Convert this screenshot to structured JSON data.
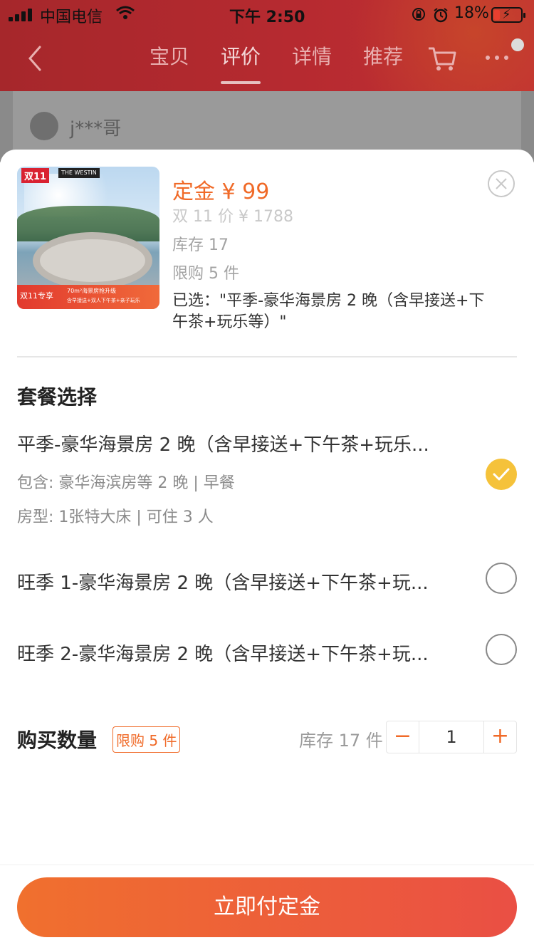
{
  "status_bar": {
    "carrier": "中国电信",
    "time": "下午 2:50",
    "battery": "18%"
  },
  "header": {
    "tabs": [
      "宝贝",
      "评价",
      "详情",
      "推荐"
    ],
    "active_tab": "评价"
  },
  "background": {
    "user_name": "j***哥"
  },
  "product": {
    "thumb_tag": "双11",
    "thumb_brand": "THE WESTIN",
    "thumb_banner_left": "双11专享",
    "thumb_banner_line1": "70m²海景房抢升级",
    "thumb_banner_line2": "含早接送+双人下午茶+亲子玩乐",
    "deposit": "定金 ¥ 99",
    "promo_price": "双 11 价 ¥ 1788",
    "stock": "库存 17",
    "purchase_limit": "限购 5 件",
    "selected": "已选：\"平季-豪华海景房 2 晚（含早接送+下午茶+玩乐等）\""
  },
  "package": {
    "section_title": "套餐选择",
    "options": [
      {
        "title": "平季-豪华海景房 2 晚（含早接送+下午茶+玩乐...",
        "includes": "包含: 豪华海滨房等 2 晚 | 早餐",
        "room_type": "房型: 1张特大床 | 可住 3 人",
        "selected": true
      },
      {
        "title": "旺季 1-豪华海景房 2 晚（含早接送+下午茶+玩...",
        "selected": false
      },
      {
        "title": "旺季 2-豪华海景房 2 晚（含早接送+下午茶+玩...",
        "selected": false
      }
    ]
  },
  "quantity": {
    "title": "购买数量",
    "limit_badge": "限购 5 件",
    "stock": "库存 17 件",
    "value": "1",
    "minus": "−",
    "plus": "+"
  },
  "footer": {
    "pay_button": "立即付定金"
  },
  "colors": {
    "accent": "#f06a28",
    "check": "#f5c23a",
    "button_start": "#f0702e",
    "button_end": "#ea4f44"
  }
}
